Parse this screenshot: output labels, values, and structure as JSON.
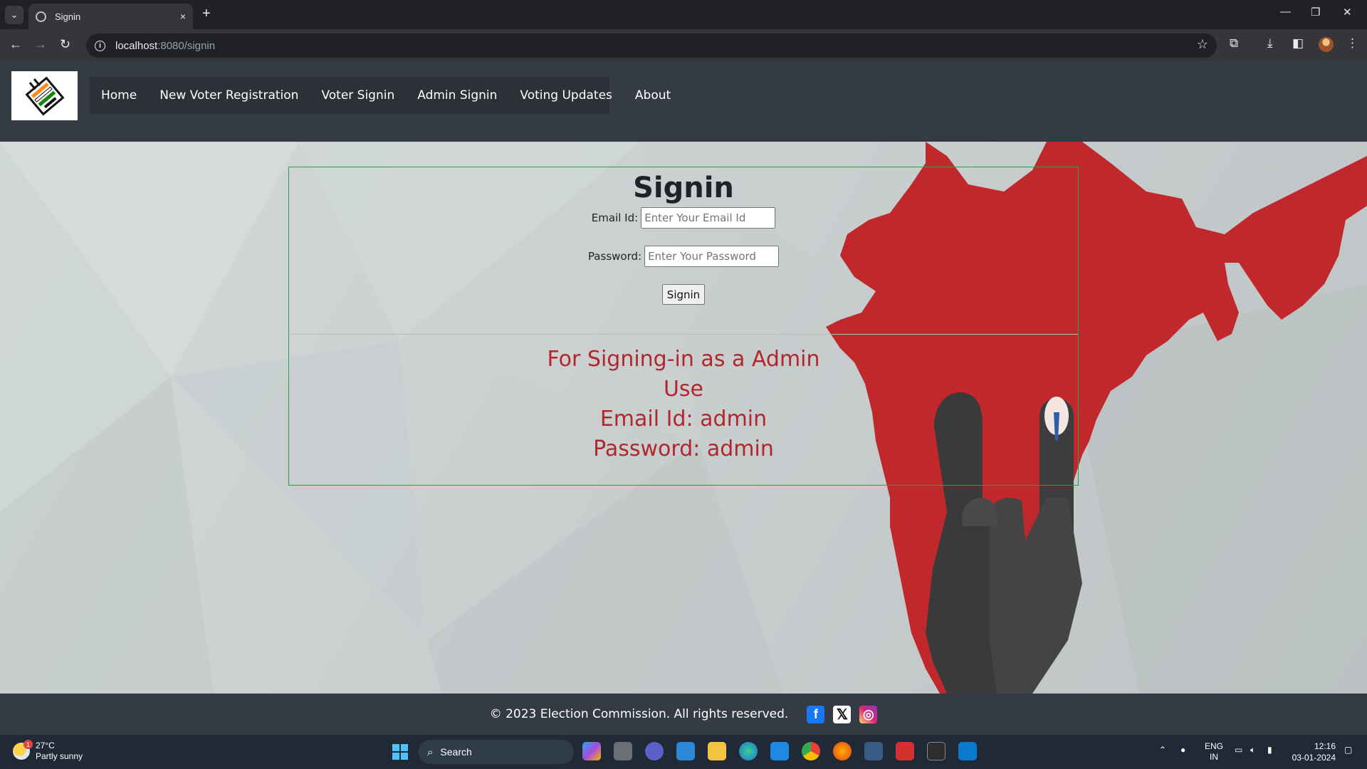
{
  "browser": {
    "tab_title": "Signin",
    "url_host": "localhost",
    "url_path": ":8080/signin",
    "new_tab": "+",
    "tab_close": "×"
  },
  "site": {
    "nav": [
      "Home",
      "New Voter Registration",
      "Voter Signin",
      "Admin Signin",
      "Voting Updates",
      "About"
    ],
    "signin": {
      "title": "Signin",
      "email_label": "Email Id:",
      "email_placeholder": "Enter Your Email Id",
      "password_label": "Password:",
      "password_placeholder": "Enter Your Password",
      "button": "Signin"
    },
    "admin_info": {
      "line1": "For Signing-in as a Admin",
      "line2": "Use",
      "line3": "Email Id: admin",
      "line4": "Password: admin"
    },
    "footer": {
      "copyright": "© 2023 Election Commission. All rights reserved.",
      "social_icons": [
        "facebook-icon",
        "x-icon",
        "instagram-icon"
      ]
    }
  },
  "taskbar": {
    "weather_temp": "27°C",
    "weather_desc": "Partly sunny",
    "weather_badge": "1",
    "search": "Search",
    "lang_1": "ENG",
    "lang_2": "IN",
    "time": "12:16",
    "date": "03-01-2024"
  },
  "colors": {
    "header_bg": "#353b44",
    "form_border": "#2ea043",
    "admin_text": "#b1272c",
    "map_red": "#c0282c"
  }
}
